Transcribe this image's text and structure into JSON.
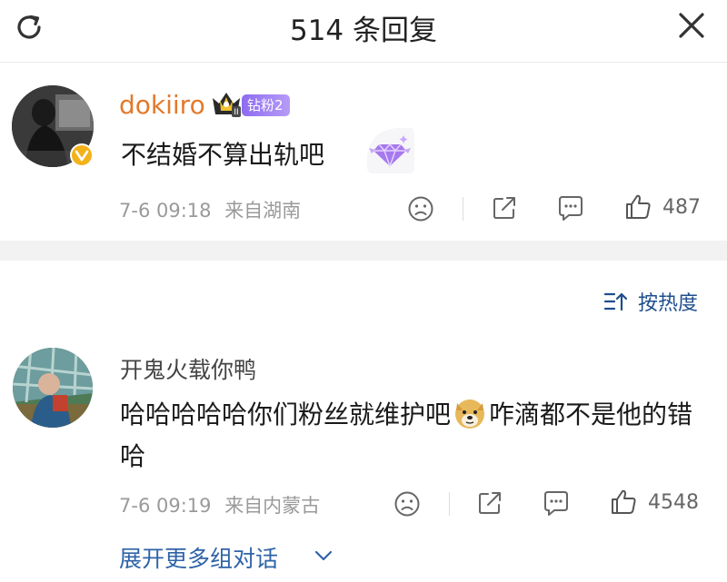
{
  "header": {
    "title": "514 条回复",
    "refresh_icon": "refresh-icon",
    "close_icon": "close-icon"
  },
  "comments": [
    {
      "username": "dokiiro",
      "username_color": "#e3792b",
      "fan_badge": "钻粉2",
      "crown_badge_icon": "crown-icon",
      "text": "不结婚不算出轨吧",
      "sticker_icon": "diamond-icon",
      "time": "7-6 09:18",
      "location": "来自湖南",
      "likes": "487"
    },
    {
      "username": "开鬼火载你鸭",
      "text_before": "哈哈哈哈哈你们粉丝就维护吧",
      "emoji_icon": "doge-emoji",
      "text_after": "咋滴都不是他的错哈",
      "time": "7-6 09:19",
      "location": "来自内蒙古",
      "likes": "4548"
    }
  ],
  "sort": {
    "label": "按热度",
    "icon": "sort-icon"
  },
  "expand": {
    "label": "展开更多组对话"
  },
  "colors": {
    "accent_link": "#2e63a8",
    "sort_text": "#1e4e8e",
    "fan_badge": "#8d6cf0",
    "meta": "#9a9a9a"
  }
}
